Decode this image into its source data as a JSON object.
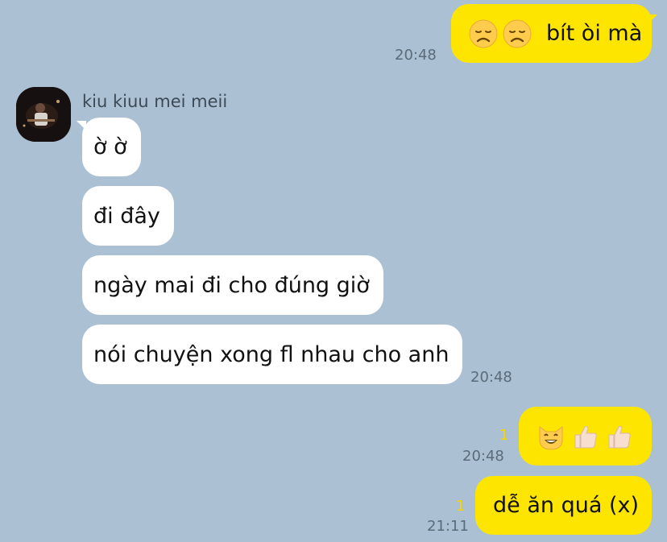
{
  "chat": {
    "partner_name": "kiu kiuu mei meii",
    "messages": [
      {
        "text": "bít òi mà",
        "time": "20:48",
        "emojis": [
          "disappointed-face-emoji",
          "disappointed-face-emoji"
        ]
      },
      {
        "text": "ờ ờ"
      },
      {
        "text": "đi đây"
      },
      {
        "text": "ngày mai đi cho đúng giờ"
      },
      {
        "text": "nói chuyện xong fl nhau cho anh",
        "time": "20:48"
      },
      {
        "emojis": [
          "grinning-cat-emoji",
          "thumbs-up-emoji",
          "thumbs-up-emoji"
        ],
        "time": "20:48",
        "unread": "1"
      },
      {
        "text": "dễ ăn quá (x)",
        "time": "21:11",
        "unread": "1"
      }
    ]
  },
  "colors": {
    "background": "#abc1d3",
    "outgoing_bubble": "#fee500",
    "incoming_bubble": "#ffffff",
    "unread_count": "#f5d400"
  }
}
